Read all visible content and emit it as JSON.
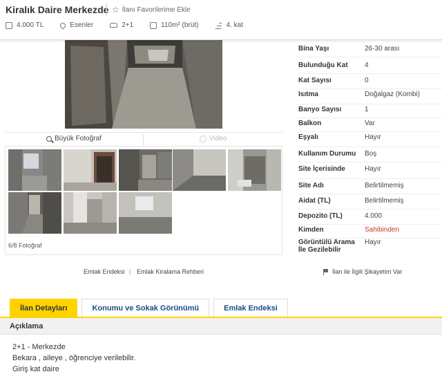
{
  "header": {
    "title": "Kiralık Daire Merkezde",
    "favorite_label": "İlanı Favorilerime Ekle",
    "meta": [
      {
        "icon": "price-icon",
        "text": "4.000 TL"
      },
      {
        "icon": "location-pin-icon",
        "text": "Esenler"
      },
      {
        "icon": "car-icon",
        "text": "2+1"
      },
      {
        "icon": "area-icon",
        "text": "110m² (brüt)"
      },
      {
        "icon": "floor-icon",
        "text": "4. kat"
      }
    ]
  },
  "gallery": {
    "big_photo_label": "Büyük Fotoğraf",
    "video_label": "Video",
    "photo_count": "6/8 Fotoğraf"
  },
  "specs": [
    {
      "key": "Bina Yaşı",
      "value": "26-30 arası"
    },
    {
      "key": "Bulunduğu Kat",
      "value": "4"
    },
    {
      "key": "Kat Sayısı",
      "value": "0"
    },
    {
      "key": "Isıtma",
      "value": "Doğalgaz (Kombi)"
    },
    {
      "key": "Banyo Sayısı",
      "value": "1"
    },
    {
      "key": "Balkon",
      "value": "Var"
    },
    {
      "key": "Eşyalı",
      "value": "Hayır"
    },
    {
      "key": "Kullanım Durumu",
      "value": "Boş"
    },
    {
      "key": "Site İçerisinde",
      "value": "Hayır"
    },
    {
      "key": "Site Adı",
      "value": "Belirtilmemiş"
    },
    {
      "key": "Aidat (TL)",
      "value": "Belirtilmemiş"
    },
    {
      "key": "Depozito (TL)",
      "value": "4.000"
    },
    {
      "key": "Kimden",
      "value": "Sahibinden"
    },
    {
      "key": "Görüntülü Arama İle Gezilebilir",
      "value": "Hayır"
    }
  ],
  "links": {
    "emlak_endeksi": "Emlak Endeksi",
    "rehber": "Emlak Kiralama Rehberi",
    "complaint": "İlan ile İlgili Şikayetim Var"
  },
  "tabs": [
    {
      "label": "İlan Detayları",
      "active": true
    },
    {
      "label": "Konumu ve Sokak Görünümü",
      "active": false
    },
    {
      "label": "Emlak Endeksi",
      "active": false
    }
  ],
  "description": {
    "title": "Açıklama",
    "lines": [
      "2+1 - Merkezde",
      "Bekara , aileye , öğrenciye verilebilir.",
      "Giriş kat daire"
    ]
  },
  "colors": {
    "accent_yellow": "#ffd300",
    "link_blue": "#1a4b86",
    "red_value": "#c0392b"
  }
}
